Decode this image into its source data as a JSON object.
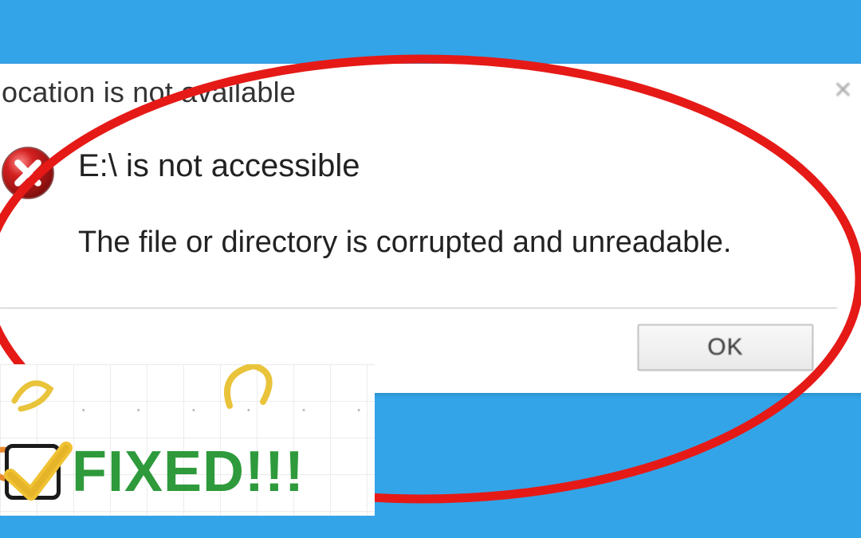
{
  "dialog": {
    "title": "ocation is not available",
    "message_title": "E:\\ is not accessible",
    "message_detail": "The file or directory is corrupted and unreadable.",
    "ok_label": "OK",
    "close_glyph": "✕"
  },
  "badge": {
    "text": "FIXED!!!"
  },
  "colors": {
    "highlight": "#e51a17",
    "badge_green": "#2e9a3b",
    "check_yellow": "#f0c233"
  }
}
